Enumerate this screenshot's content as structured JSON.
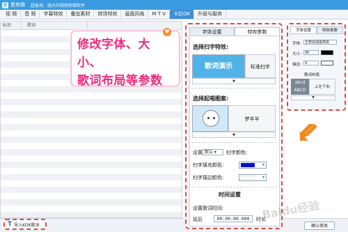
{
  "app": {
    "logo_glyph": "爱",
    "name": "爱剪辑",
    "slogan": "超易用、强大的视频剪辑软件"
  },
  "menu": {
    "tabs": [
      "视 频",
      "音 频",
      "字幕特效",
      "叠加素材",
      "转场特效",
      "画面风格",
      "M T V",
      "卡拉OK",
      "升级与服务"
    ],
    "active_index": 7
  },
  "list": {
    "headers": {
      "index": "标识",
      "lyrics": "歌词",
      "time": ""
    }
  },
  "callout": {
    "line1": "修改字体、大小、",
    "line2": "歌词布局等参数"
  },
  "import_button": {
    "icon_glyph": "T",
    "label": "导入KOK歌词"
  },
  "mid_panel": {
    "tabs": [
      "字体设置",
      "特效参数"
    ],
    "choose_effect": "选择扫字特效:",
    "effect_preview": "歌词演示",
    "effect_option": "标准扫字",
    "choose_pattern": "选择起唱图案:",
    "pattern_option": "梦羊羊",
    "settings_label": "设置",
    "default_select": "默认",
    "text_color_label": "扫字颜色:",
    "fill_color_label": "扫字填充颜色:",
    "fill_color": "#0b0bd0",
    "stroke_color_label": "扫字描边颜色:",
    "stroke_color": "#ffffff",
    "time_section": "时间设置",
    "lyric_time_label": "设置歌词时间:",
    "delay_label": "延后",
    "delay_value": "00:00:00.000",
    "duration_unit": "时长"
  },
  "right_panel": {
    "tabs": [
      "字体设置",
      "特效参数"
    ],
    "font_label": "字体:",
    "font_value": "王菲完城黑简体",
    "size_label": "大小:",
    "size_value": "90",
    "stroke_label": "描边:",
    "stroke_value": "9",
    "layout_section": "歌词布局",
    "layout_preview_line1": "abcd",
    "layout_preview_line2": "ABCD",
    "layout_option": "上左下右"
  },
  "confirm_button": "确认修改",
  "watermark": "Baidu经验",
  "colors": {
    "titlebar": "#3a9be0",
    "accent_dashed": "#e04a3a",
    "callout_text": "#ee2a7f",
    "arrow": "#f28a1f"
  }
}
